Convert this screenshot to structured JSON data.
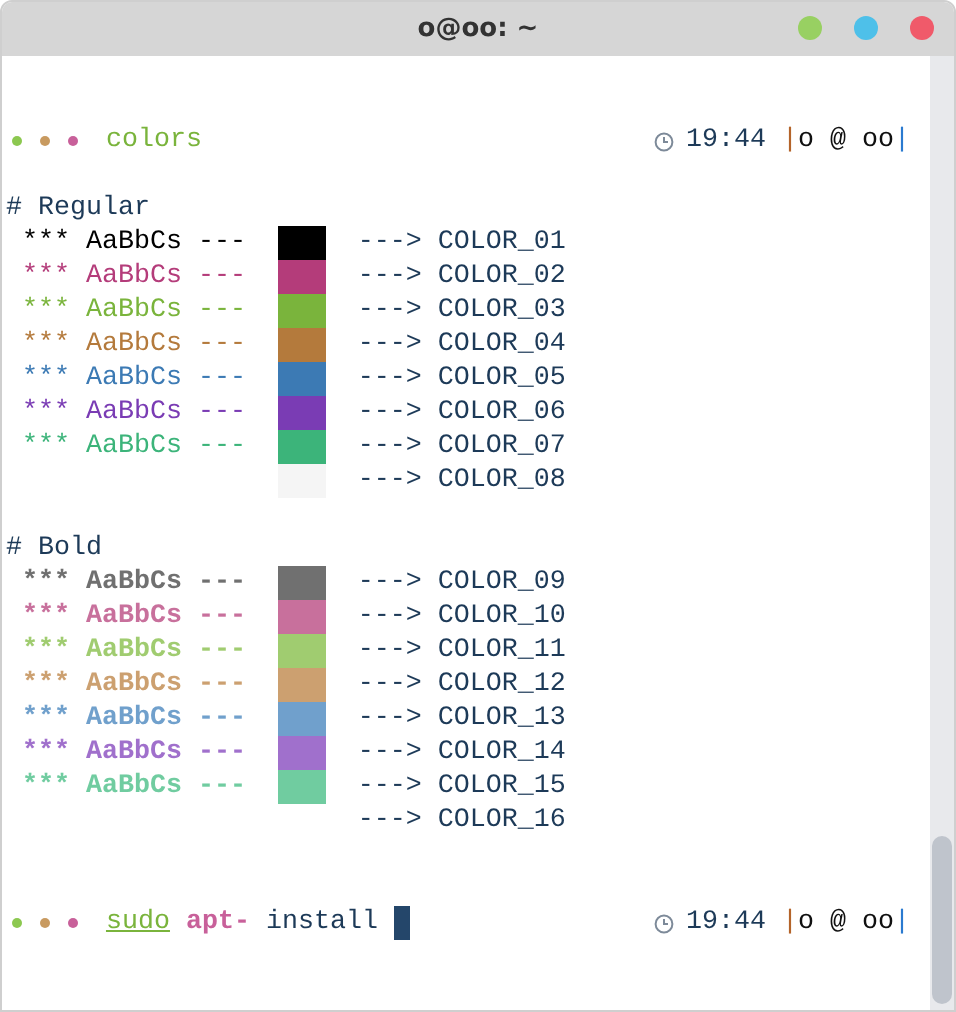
{
  "window": {
    "title": "o@oo: ~"
  },
  "prompts": [
    {
      "tokens": [
        {
          "text": "colors",
          "kind": "dir"
        }
      ],
      "cursor": false,
      "time": "19:44",
      "host": {
        "open": "|",
        "text": "o @ oo",
        "close": "|"
      }
    },
    {
      "tokens": [
        {
          "text": "sudo",
          "kind": "command"
        },
        {
          "text": "apt-",
          "kind": "option"
        },
        {
          "text": "install",
          "kind": "arg"
        }
      ],
      "cursor": true,
      "time": "19:44",
      "host": {
        "open": "|",
        "text": "o @ oo",
        "close": "|"
      }
    }
  ],
  "sections": [
    {
      "heading": "# Regular",
      "bold": false,
      "rows": [
        {
          "stars": "***",
          "sample": "AaBbCs",
          "dashes": "---",
          "color": "#000000",
          "arrow": "--->",
          "label": "COLOR_01"
        },
        {
          "stars": "***",
          "sample": "AaBbCs",
          "dashes": "---",
          "color": "#b43c7a",
          "arrow": "--->",
          "label": "COLOR_02"
        },
        {
          "stars": "***",
          "sample": "AaBbCs",
          "dashes": "---",
          "color": "#7ab43c",
          "arrow": "--->",
          "label": "COLOR_03"
        },
        {
          "stars": "***",
          "sample": "AaBbCs",
          "dashes": "---",
          "color": "#b47a3c",
          "arrow": "--->",
          "label": "COLOR_04"
        },
        {
          "stars": "***",
          "sample": "AaBbCs",
          "dashes": "---",
          "color": "#3c7ab4",
          "arrow": "--->",
          "label": "COLOR_05"
        },
        {
          "stars": "***",
          "sample": "AaBbCs",
          "dashes": "---",
          "color": "#7a3cb4",
          "arrow": "--->",
          "label": "COLOR_06"
        },
        {
          "stars": "***",
          "sample": "AaBbCs",
          "dashes": "---",
          "color": "#3cb47a",
          "arrow": "--->",
          "label": "COLOR_07"
        },
        {
          "color": "#f5f5f5",
          "arrow": "--->",
          "label": "COLOR_08"
        }
      ]
    },
    {
      "heading": "# Bold",
      "bold": true,
      "rows": [
        {
          "stars": "***",
          "sample": "AaBbCs",
          "dashes": "---",
          "color": "#707070",
          "arrow": "--->",
          "label": "COLOR_09"
        },
        {
          "stars": "***",
          "sample": "AaBbCs",
          "dashes": "---",
          "color": "#c8709c",
          "arrow": "--->",
          "label": "COLOR_10"
        },
        {
          "stars": "***",
          "sample": "AaBbCs",
          "dashes": "---",
          "color": "#a0cc70",
          "arrow": "--->",
          "label": "COLOR_11"
        },
        {
          "stars": "***",
          "sample": "AaBbCs",
          "dashes": "---",
          "color": "#cca070",
          "arrow": "--->",
          "label": "COLOR_12"
        },
        {
          "stars": "***",
          "sample": "AaBbCs",
          "dashes": "---",
          "color": "#70a0cc",
          "arrow": "--->",
          "label": "COLOR_13"
        },
        {
          "stars": "***",
          "sample": "AaBbCs",
          "dashes": "---",
          "color": "#a070cc",
          "arrow": "--->",
          "label": "COLOR_14"
        },
        {
          "stars": "***",
          "sample": "AaBbCs",
          "dashes": "---",
          "color": "#70cca0",
          "arrow": "--->",
          "label": "COLOR_15"
        },
        {
          "arrow": "--->",
          "label": "COLOR_16"
        }
      ]
    }
  ]
}
